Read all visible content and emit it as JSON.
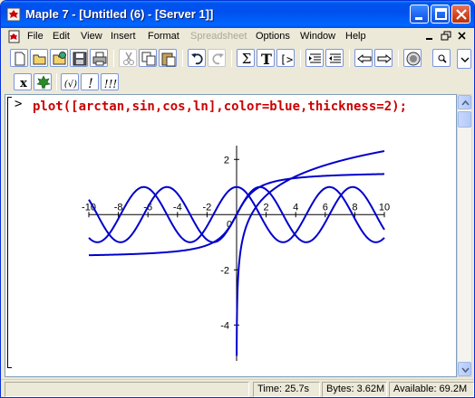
{
  "window": {
    "title": "Maple 7  - [Untitled (6) - [Server 1]]"
  },
  "menu": {
    "items": [
      "File",
      "Edit",
      "View",
      "Insert",
      "Format",
      "Spreadsheet",
      "Options",
      "Window",
      "Help"
    ],
    "disabled": [
      "Spreadsheet"
    ]
  },
  "toolbar1": {
    "tools": [
      "new-icon",
      "open-icon",
      "open-url-icon",
      "save-icon",
      "print-icon",
      "cut-icon",
      "copy-icon",
      "paste-icon",
      "undo-icon",
      "redo-icon",
      "sigma-icon",
      "text-T-icon",
      "prompt-icon",
      "indent-icon",
      "outdent-icon",
      "back-arrow-icon",
      "forward-arrow-icon",
      "stop-icon",
      "zoom-icon"
    ],
    "text_labels": {
      "sigma": "Σ",
      "text": "T",
      "prompt": "[>"
    }
  },
  "toolbar2": {
    "labels": {
      "x": "x",
      "check": "(√)",
      "exec": "!",
      "exec_all": "!!!"
    }
  },
  "worksheet": {
    "prompt": ">",
    "command": "plot([arctan,sin,cos,ln],color=blue,thickness=2);"
  },
  "chart_data": {
    "type": "line",
    "series": [
      {
        "function": "arctan",
        "x": [
          -10,
          -8,
          -6,
          -4,
          -2,
          0,
          2,
          4,
          6,
          8,
          10
        ],
        "y": [
          -1.47,
          -1.45,
          -1.41,
          -1.33,
          -1.11,
          0,
          1.11,
          1.33,
          1.41,
          1.45,
          1.47
        ]
      },
      {
        "function": "sin",
        "x": [
          -10,
          -8,
          -6,
          -4,
          -2,
          0,
          2,
          4,
          6,
          8,
          10
        ],
        "y": [
          0.54,
          -0.99,
          0.28,
          0.76,
          -0.91,
          0,
          0.91,
          -0.76,
          -0.28,
          0.99,
          -0.54
        ]
      },
      {
        "function": "cos",
        "x": [
          -10,
          -8,
          -6,
          -4,
          -2,
          0,
          2,
          4,
          6,
          8,
          10
        ],
        "y": [
          -0.84,
          -0.15,
          0.96,
          -0.65,
          -0.42,
          1,
          -0.42,
          -0.65,
          0.96,
          -0.15,
          -0.84
        ]
      },
      {
        "function": "ln",
        "x": [
          0.1,
          0.5,
          1,
          2,
          4,
          6,
          8,
          10
        ],
        "y": [
          -2.3,
          -0.69,
          0,
          0.69,
          1.39,
          1.79,
          2.08,
          2.3
        ]
      }
    ],
    "xlim": [
      -10,
      10
    ],
    "ylim": [
      -5.3,
      2.5
    ],
    "x_ticks": [
      "-10",
      "-8",
      "-6",
      "-4",
      "-2",
      "0",
      "2",
      "4",
      "6",
      "8",
      "10"
    ],
    "y_ticks": [
      "2",
      "-2",
      "-4"
    ],
    "line_color": "#0000cc",
    "grid": false
  },
  "status": {
    "time": "Time:  25.7s",
    "bytes": "Bytes: 3.62M",
    "available": "Available: 69.2M"
  }
}
